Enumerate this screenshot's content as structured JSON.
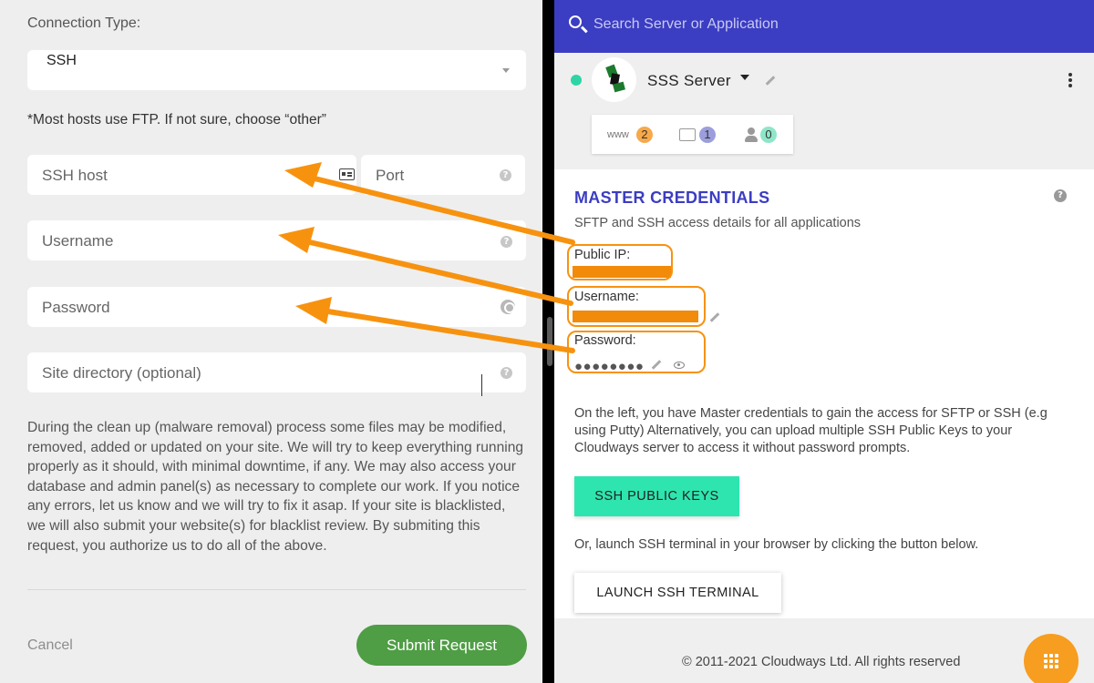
{
  "form": {
    "connection_label": "Connection Type:",
    "connection_value": "SSH",
    "hint": "*Most hosts use FTP. If not sure, choose “other”",
    "ssh_host_placeholder": "SSH host",
    "port_placeholder": "Port",
    "username_placeholder": "Username",
    "password_placeholder": "Password",
    "site_dir_placeholder": "Site directory (optional)",
    "disclaimer": "During the clean up (malware removal) process some files may be modified, removed, added or updated on your site. We will try to keep everything running properly as it should, with minimal downtime, if any. We may also access your database and admin panel(s) as necessary to complete our work. If you notice any errors, let us know and we will try to fix it asap. If your site is blacklisted, we will also submit your website(s) for blacklist review. By submiting this request, you authorize us to do all of the above.",
    "cancel_label": "Cancel",
    "submit_label": "Submit Request",
    "help_glyph": "?"
  },
  "server_panel": {
    "search_placeholder": "Search Server or Application",
    "server_name": "SSS Server",
    "stats": {
      "www_label": "www",
      "apps_count": "2",
      "files_count": "1",
      "users_count": "0"
    },
    "master_credentials": {
      "title": "MASTER CREDENTIALS",
      "subtitle": "SFTP and SSH access details for all applications",
      "public_ip_label": "Public IP:",
      "username_label": "Username:",
      "password_label": "Password:",
      "password_mask": "●●●●●●●●",
      "description": "On the left, you have Master credentials to gain the access for SFTP or SSH (e.g using Putty) Alternatively, you can upload multiple SSH Public Keys to your Cloudways server to access it without password prompts.",
      "ssh_keys_button": "SSH PUBLIC KEYS",
      "terminal_hint": "Or, launch SSH terminal in your browser by clicking the button below.",
      "terminal_button": "LAUNCH SSH TERMINAL"
    },
    "footer": "© 2011-2021 Cloudways Ltd. All rights reserved"
  },
  "colors": {
    "primary_blue": "#3b3dc2",
    "accent_green": "#2ee5b0",
    "submit_green": "#4f9d45",
    "annotation_orange": "#f7920f",
    "status_online": "#2ed5a4"
  },
  "icons": [
    "search-icon",
    "chevron-down-icon",
    "id-card-icon",
    "help-icon",
    "key-icon",
    "pencil-icon",
    "eye-icon",
    "kebab-menu-icon",
    "folder-icon",
    "user-icon",
    "grid-icon"
  ]
}
